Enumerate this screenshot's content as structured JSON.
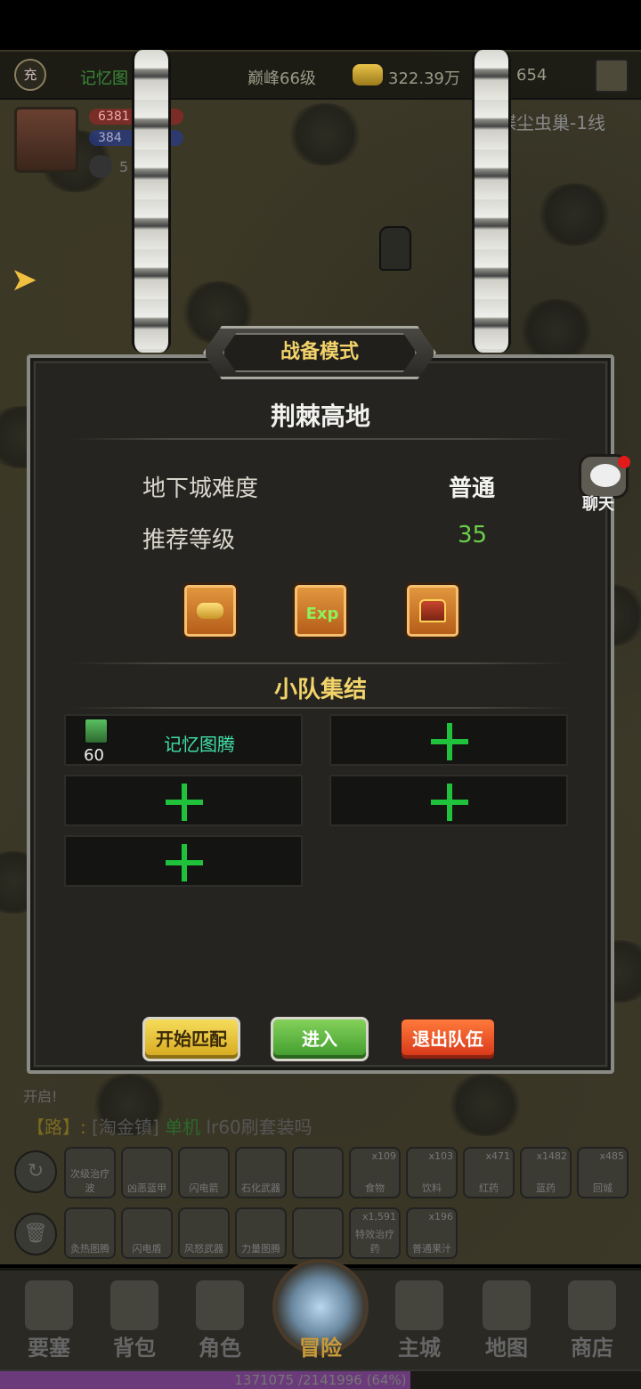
{
  "topbar": {
    "vip_badge": "充",
    "guild_name": "记忆图",
    "peak_level": "巅峰66级",
    "gold": "322.39万",
    "gems": "654",
    "zone": "蝶尘虫巢-1线"
  },
  "player": {
    "hp": "6381",
    "mp": "384",
    "extra": "5"
  },
  "modal": {
    "mode_title": "战备模式",
    "dungeon_name": "荆棘高地",
    "difficulty_label": "地下城难度",
    "difficulty_value": "普通",
    "rec_level_label": "推荐等级",
    "rec_level_value": "35",
    "rewards": [
      "gold-icon",
      "exp-icon",
      "chest-icon"
    ],
    "exp_text": "Exp",
    "section_title": "小队集结",
    "member": {
      "level": "60",
      "name": "记忆图腾"
    },
    "buttons": {
      "match": "开始匹配",
      "enter": "进入",
      "leave": "退出队伍"
    }
  },
  "chat": {
    "label": "聊天"
  },
  "log": {
    "line1": "开启!",
    "line2_tag": "【路】:",
    "line2_place": "[淘金镇]",
    "line2_name": "单机",
    "line2_msg": "lr60刷套装吗"
  },
  "skills_row1": [
    {
      "label": "次级治疗波"
    },
    {
      "label": "凶恶蓝甲"
    },
    {
      "label": "闪电箭"
    },
    {
      "label": "石化武器"
    },
    {
      "label": ""
    },
    {
      "label": "食物",
      "count": "x109"
    },
    {
      "label": "饮料",
      "count": "x103"
    },
    {
      "label": "红药",
      "count": "x471"
    },
    {
      "label": "蓝药",
      "count": "x1482"
    },
    {
      "label": "回城",
      "count": "x485"
    }
  ],
  "skills_row2": [
    {
      "label": "灸热图腾"
    },
    {
      "label": "闪电盾"
    },
    {
      "label": "风怒武器"
    },
    {
      "label": "力量图腾"
    },
    {
      "label": ""
    },
    {
      "label": "特效治疗药",
      "count": "x1,591"
    },
    {
      "label": "普通果汁",
      "count": "x196"
    }
  ],
  "nav": [
    {
      "label": "要塞"
    },
    {
      "label": "背包"
    },
    {
      "label": "角色"
    },
    {
      "label": "冒险"
    },
    {
      "label": "主城"
    },
    {
      "label": "地图"
    },
    {
      "label": "商店"
    }
  ],
  "exp": {
    "text": "1371075 /2141996 (64%)",
    "fraction": 0.64
  }
}
